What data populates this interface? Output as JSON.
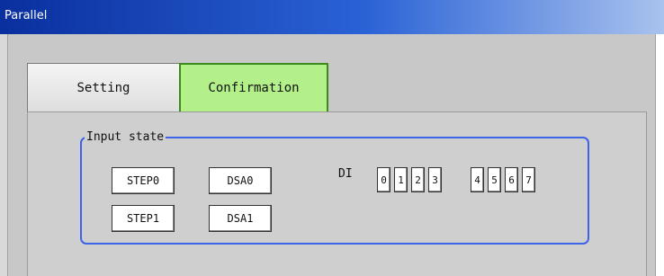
{
  "window": {
    "title": "Parallel"
  },
  "tabs": [
    {
      "label": "Setting",
      "active": false
    },
    {
      "label": "Confirmation",
      "active": true
    }
  ],
  "input_state": {
    "group_label": "Input state",
    "step_signals": [
      "STEP0",
      "STEP1"
    ],
    "dsa_signals": [
      "DSA0",
      "DSA1"
    ],
    "di_label": "DI",
    "di_bits": [
      "0",
      "1",
      "2",
      "3",
      "4",
      "5",
      "6",
      "7"
    ]
  },
  "colors": {
    "active_tab": "#b3f08a",
    "group_border": "#3b64e6",
    "titlebar_start": "#0a2f9e",
    "titlebar_end": "#a9c2ee"
  }
}
